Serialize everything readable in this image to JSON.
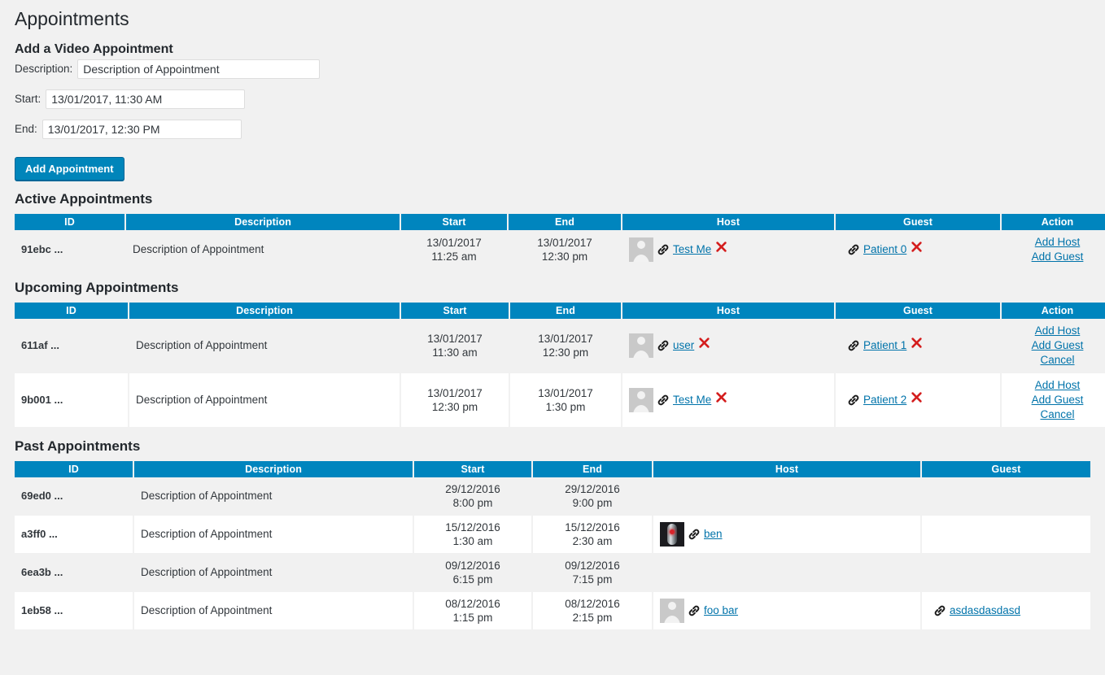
{
  "page_title": "Appointments",
  "form": {
    "heading": "Add a Video Appointment",
    "description_label": "Description:",
    "description_value": "Description of Appointment",
    "description_placeholder": "Description of Appointment",
    "start_label": "Start:",
    "start_value": "13/01/2017, 11:30 AM",
    "end_label": "End:",
    "end_value": "13/01/2017, 12:30 PM",
    "submit_label": "Add Appointment"
  },
  "colors": {
    "header_blue": "#0085be",
    "button_blue": "#0085ba",
    "link_blue": "#0073aa",
    "page_bg": "#f1f1f1",
    "x_red": "#d41d1d"
  },
  "icons": {
    "link": "link-icon",
    "remove": "x-icon",
    "avatar_placeholder": "avatar-placeholder-icon"
  },
  "active": {
    "title": "Active Appointments",
    "columns": [
      "ID",
      "Description",
      "Start",
      "End",
      "Host",
      "Guest",
      "Action"
    ],
    "rows": [
      {
        "id": "91ebc ...",
        "description": "Description of Appointment",
        "start_date": "13/01/2017",
        "start_time": "11:25 am",
        "end_date": "13/01/2017",
        "end_time": "12:30 pm",
        "host": {
          "name": "Test Me ",
          "avatar": "silhouette",
          "removable": true
        },
        "guest": {
          "name": "Patient 0 ",
          "avatar": "none",
          "removable": true
        },
        "actions": [
          "Add Host",
          "Add Guest"
        ]
      }
    ]
  },
  "upcoming": {
    "title": "Upcoming Appointments",
    "columns": [
      "ID",
      "Description",
      "Start",
      "End",
      "Host",
      "Guest",
      "Action"
    ],
    "rows": [
      {
        "id": "611af ...",
        "description": "Description of Appointment",
        "start_date": "13/01/2017",
        "start_time": "11:30 am",
        "end_date": "13/01/2017",
        "end_time": "12:30 pm",
        "host": {
          "name": "user ",
          "avatar": "silhouette",
          "removable": true
        },
        "guest": {
          "name": "Patient 1",
          "avatar": "none",
          "removable": true
        },
        "actions": [
          "Add Host",
          "Add Guest",
          "Cancel"
        ]
      },
      {
        "id": "9b001 ...",
        "description": "Description of Appointment",
        "start_date": "13/01/2017",
        "start_time": "12:30 pm",
        "end_date": "13/01/2017",
        "end_time": "1:30 pm",
        "host": {
          "name": "Test Me ",
          "avatar": "silhouette",
          "removable": true
        },
        "guest": {
          "name": "Patient 2 ",
          "avatar": "none",
          "removable": true
        },
        "actions": [
          "Add Host",
          "Add Guest",
          "Cancel"
        ]
      }
    ]
  },
  "past": {
    "title": "Past Appointments",
    "columns": [
      "ID",
      "Description",
      "Start",
      "End",
      "Host",
      "Guest"
    ],
    "rows": [
      {
        "id": "69ed0 ...",
        "description": "Description of Appointment",
        "start_date": "29/12/2016",
        "start_time": "8:00 pm",
        "end_date": "29/12/2016",
        "end_time": "9:00 pm",
        "host": null,
        "guest": null
      },
      {
        "id": "a3ff0 ...",
        "description": "Description of Appointment",
        "start_date": "15/12/2016",
        "start_time": "1:30 am",
        "end_date": "15/12/2016",
        "end_time": "2:30 am",
        "host": {
          "name": "ben ",
          "avatar": "photo",
          "removable": false
        },
        "guest": null
      },
      {
        "id": "6ea3b ...",
        "description": "Description of Appointment",
        "start_date": "09/12/2016",
        "start_time": "6:15 pm",
        "end_date": "09/12/2016",
        "end_time": "7:15 pm",
        "host": null,
        "guest": null
      },
      {
        "id": "1eb58 ...",
        "description": "Description of Appointment",
        "start_date": "08/12/2016",
        "start_time": "1:15 pm",
        "end_date": "08/12/2016",
        "end_time": "2:15 pm",
        "host": {
          "name": "foo bar ",
          "avatar": "silhouette",
          "removable": false
        },
        "guest": {
          "name": "asdasdasdasd ",
          "avatar": "none",
          "removable": false
        }
      }
    ]
  }
}
